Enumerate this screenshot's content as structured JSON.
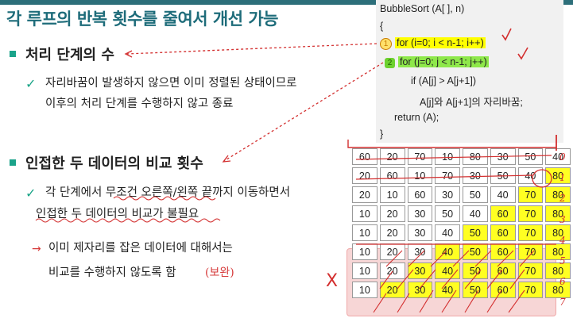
{
  "title": "각 루프의 반복 횟수를 줄여서 개선 가능",
  "section1": {
    "heading": "처리 단계의 수",
    "text_line1": "자리바꿈이 발생하지 않으면 이미 정렬된 상태이므로",
    "text_line2": "이후의 처리 단계를 수행하지 않고 종료"
  },
  "section2": {
    "heading": "인접한 두 데이터의 비교 횟수",
    "text_line1": "각 단계에서 무조건 오른쪽/왼쪽 끝까지 이동하면서",
    "text_line2": "인접한 두 데이터의 비교가 불필요",
    "sub_line1": "이미 제자리를 잡은 데이터에 대해서는",
    "sub_line2": "비교를 수행하지 않도록 함",
    "handwritten_note": "(보완)"
  },
  "code": {
    "line1": "BubbleSort (A[ ], n)",
    "line2": "{",
    "num1": "1",
    "line3": "for (i=0; i < n-1; i++)",
    "num2": "2",
    "line4": "for (j=0; j < n-1; j++)",
    "line5": "if (A[j] > A[j+1])",
    "line6": "A[j]와 A[j+1]의 자리바꿈;",
    "line7": "return (A);",
    "line8": "}"
  },
  "grid": {
    "rows": [
      [
        "60",
        "20",
        "70",
        "10",
        "80",
        "30",
        "50",
        "40"
      ],
      [
        "20",
        "60",
        "10",
        "70",
        "30",
        "50",
        "40",
        "80"
      ],
      [
        "20",
        "10",
        "60",
        "30",
        "50",
        "40",
        "70",
        "80"
      ],
      [
        "10",
        "20",
        "30",
        "50",
        "40",
        "60",
        "70",
        "80"
      ],
      [
        "10",
        "20",
        "30",
        "40",
        "50",
        "60",
        "70",
        "80"
      ],
      [
        "10",
        "20",
        "30",
        "40",
        "50",
        "60",
        "70",
        "80"
      ],
      [
        "10",
        "20",
        "30",
        "40",
        "50",
        "60",
        "70",
        "80"
      ],
      [
        "10",
        "20",
        "30",
        "40",
        "50",
        "60",
        "70",
        "80"
      ]
    ],
    "yellow_from": [
      8,
      7,
      6,
      5,
      4,
      3,
      2,
      1
    ]
  },
  "row_numbers": [
    "0",
    "1",
    "2",
    "3",
    "4",
    "5",
    "6",
    "7"
  ],
  "x_mark": "X"
}
